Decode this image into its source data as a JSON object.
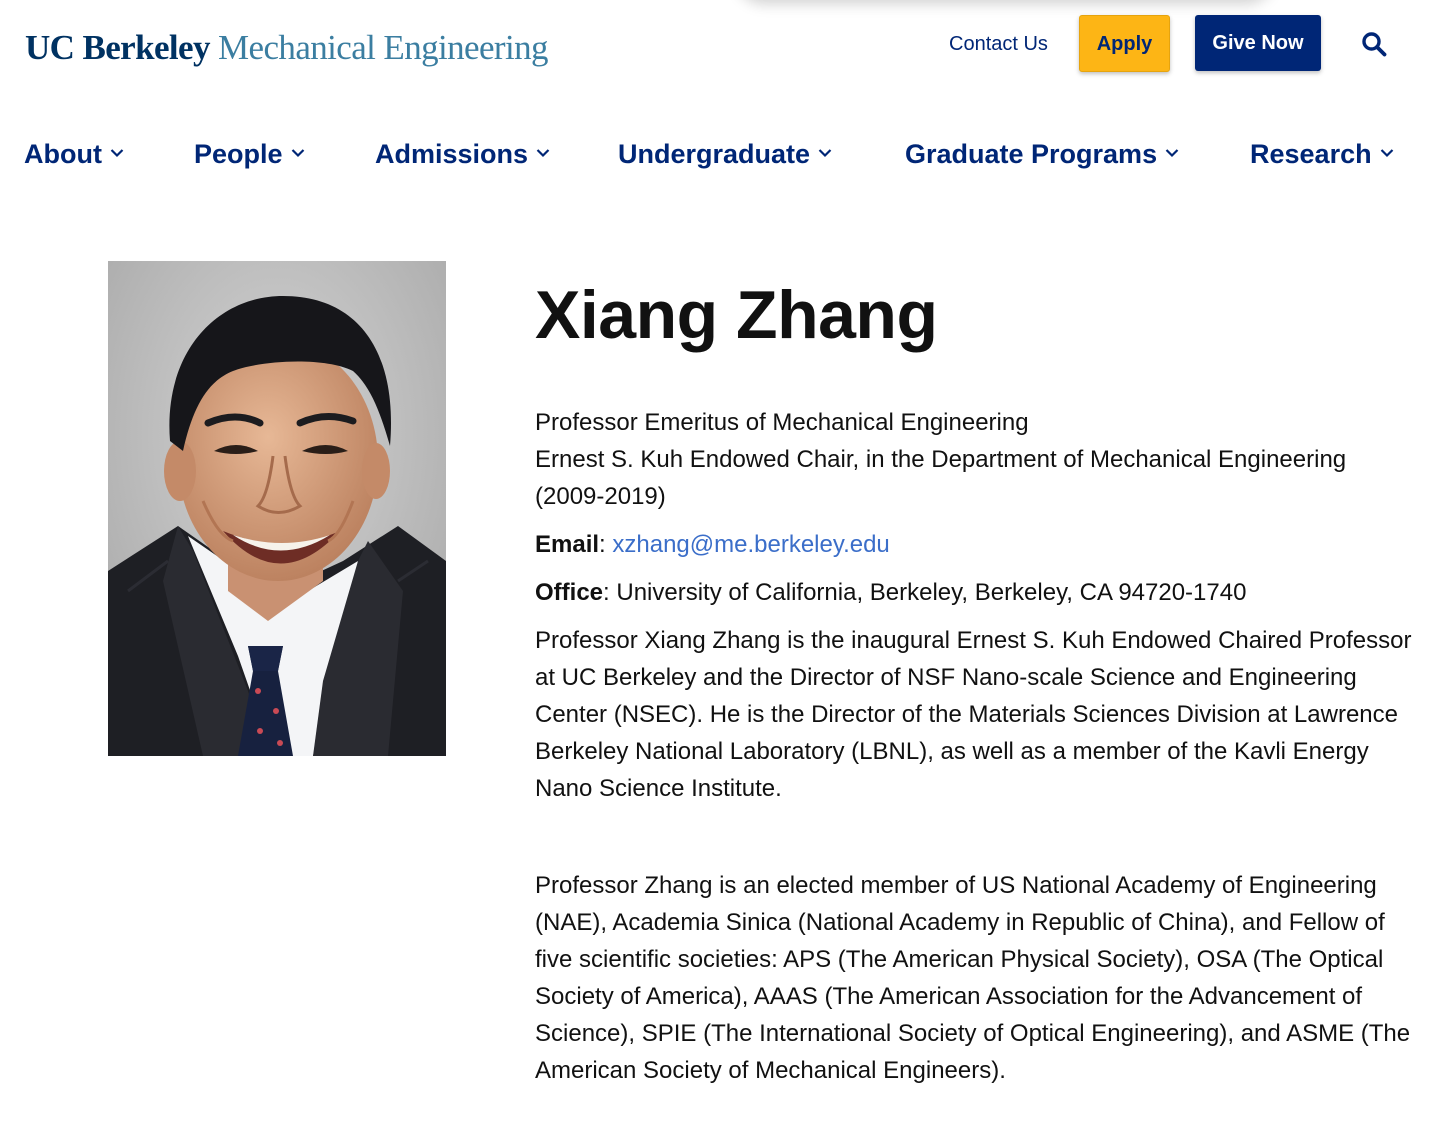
{
  "header": {
    "logo_primary": "UC Berkeley",
    "logo_secondary": "Mechanical Engineering",
    "contact_label": "Contact Us",
    "apply_label": "Apply",
    "give_label": "Give Now",
    "search_icon": "search-icon"
  },
  "nav": {
    "items": [
      {
        "label": "About"
      },
      {
        "label": "People"
      },
      {
        "label": "Admissions"
      },
      {
        "label": "Undergraduate"
      },
      {
        "label": "Graduate Programs"
      },
      {
        "label": "Research"
      }
    ],
    "dropdown_icon": "chevron-down-icon"
  },
  "profile": {
    "name": "Xiang Zhang",
    "title_1": "Professor Emeritus of Mechanical Engineering",
    "title_2": "Ernest S. Kuh Endowed Chair, in the Department of Mechanical Engineering",
    "title_3": "(2009-2019)",
    "email_label": "Email",
    "email": "xzhang@me.berkeley.edu",
    "office_label": "Office",
    "office": "University of California, Berkeley, Berkeley, CA 94720-1740",
    "bio_1": "Professor Xiang Zhang is the inaugural Ernest S. Kuh Endowed Chaired Professor at UC Berkeley and the Director of NSF Nano-scale Science and Engineering Center (NSEC). He is the Director of the Materials Sciences Division at Lawrence Berkeley National Laboratory (LBNL), as well as a member of the Kavli Energy Nano Science Institute.",
    "bio_2": "Professor Zhang is an elected member of US National Academy of Engineering (NAE), Academia Sinica (National Academy in Republic of China), and Fellow of five scientific societies: APS (The American Physical Society), OSA (The Optical Society of America), AAAS (The American Association for the Advancement of Science), SPIE (The International Society of Optical Engineering), and ASME (The American Society of Mechanical Engineers)."
  },
  "colors": {
    "berkeley_blue": "#002676",
    "logo_blue": "#003262",
    "founders_rock": "#3b7ea1",
    "california_gold": "#fdb515",
    "link_blue": "#3b6ec9"
  }
}
